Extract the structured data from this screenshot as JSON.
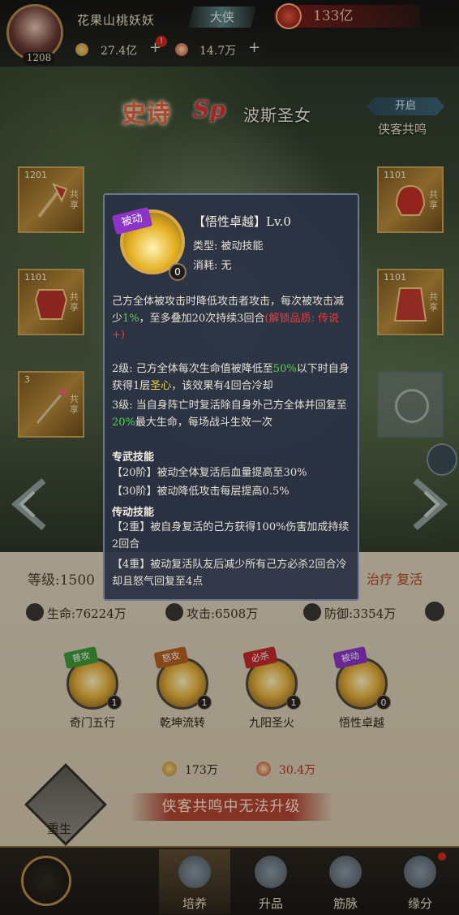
{
  "player": {
    "name": "花果山桃妖妖",
    "level": "1208",
    "rank": "大侠",
    "power": "133亿"
  },
  "currencies": [
    {
      "value": "27.4亿"
    },
    {
      "value": "14.7万"
    }
  ],
  "hero": {
    "rarity": "史诗",
    "sp": "Sp",
    "name": "波斯圣女"
  },
  "resonance": {
    "open_label": "开启",
    "label": "侠客共鸣"
  },
  "equipment": {
    "left": [
      {
        "level": "1201",
        "share": "共享"
      },
      {
        "level": "1101",
        "share": "共享"
      },
      {
        "level": "3",
        "share": "共享"
      }
    ],
    "right": [
      {
        "level": "1101",
        "share": "共享"
      },
      {
        "level": "1101",
        "share": "共享"
      }
    ]
  },
  "tooltip": {
    "tag": "被动",
    "count": "0",
    "title": "【悟性卓越】Lv.0",
    "type": "类型: 被动技能",
    "cost": "消耗: 无",
    "desc_a": "己方全体被攻击时降低攻击者攻击，每次被攻击减少",
    "desc_b": "1%",
    "desc_c": "，至多叠加20次持续3回合",
    "desc_d": "(解锁品质: 传说+)",
    "lv2_a": "2级: 己方全体每次生命值被降低至",
    "lv2_b": "50%",
    "lv2_c": "以下时自身获得1层",
    "lv2_d": "圣心",
    "lv2_e": "，该效果有4回合冷却",
    "lv3_a": "3级: 当自身阵亡时复活除自身外己方全体并回复至",
    "lv3_b": "20%",
    "lv3_c": "最大生命，每场战斗生效一次",
    "exclusive_head": "专武技能",
    "exclusive_1": "【20阶】被动全体复活后血量提高至30%",
    "exclusive_2": "【30阶】被动降低攻击每层提高0.5%",
    "legacy_head": "传动技能",
    "legacy_1": "【2重】被自身复活的己方获得100%伤害加成持续2回合",
    "legacy_2": "【4重】被动复活队友后减少所有己方必杀2回合冷却且怒气回复至4点"
  },
  "panel": {
    "level": "等级:1500",
    "tags": "治疗 复活",
    "hp": "生命:76224万",
    "atk": "攻击:6508万",
    "def": "防御:3354万"
  },
  "skills": [
    {
      "tag": "普攻",
      "tag_color": "#3f9a3a",
      "count": "1",
      "name": "奇门五行"
    },
    {
      "tag": "怒攻",
      "tag_color": "#b5601f",
      "count": "1",
      "name": "乾坤流转"
    },
    {
      "tag": "必杀",
      "tag_color": "#c22a2a",
      "count": "1",
      "name": "九阳圣火"
    },
    {
      "tag": "被动",
      "tag_color": "#8c34c7",
      "count": "0",
      "name": "悟性卓越"
    }
  ],
  "costs": [
    {
      "value": "173万"
    },
    {
      "value": "30.4万"
    }
  ],
  "rebirth_label": "重生",
  "upgrade_banner": "侠客共鸣中无法升级",
  "tabs": [
    {
      "label": "培养"
    },
    {
      "label": "升品"
    },
    {
      "label": "筋脉"
    },
    {
      "label": "缘分"
    }
  ]
}
